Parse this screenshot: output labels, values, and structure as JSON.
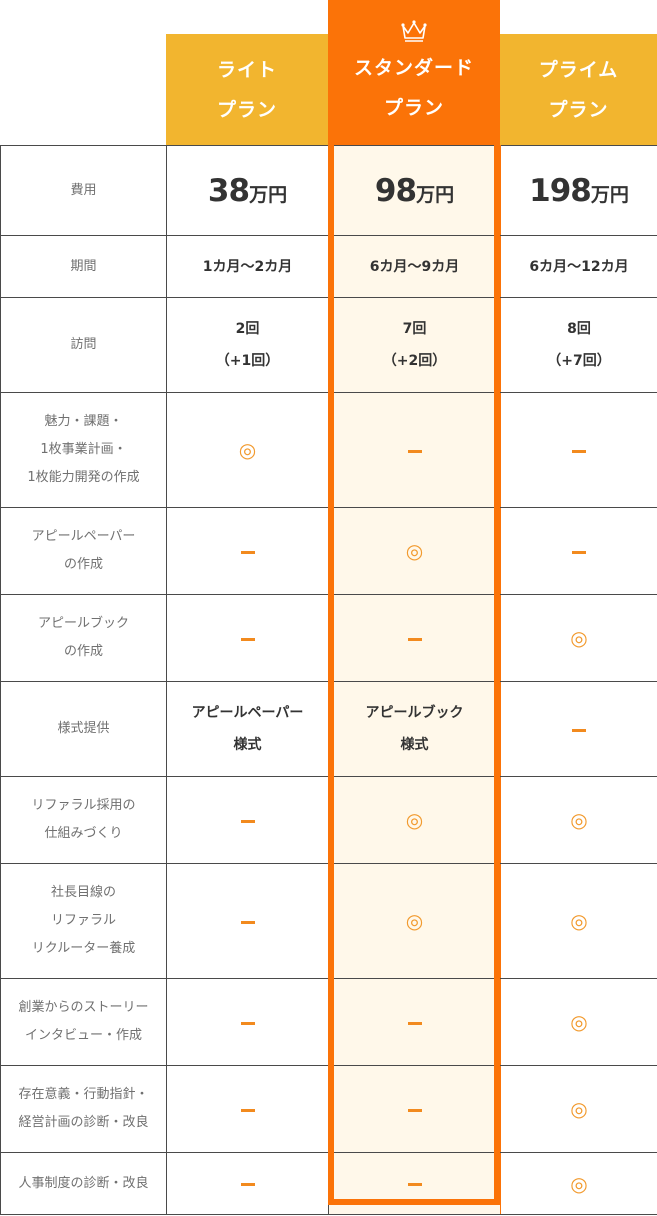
{
  "plans": {
    "light": {
      "line1": "ライト",
      "line2": "プラン"
    },
    "standard": {
      "line1": "スタンダード",
      "line2": "プラン"
    },
    "prime": {
      "line1": "プライム",
      "line2": "プラン"
    }
  },
  "icons": {
    "crown": "crown-icon",
    "double_circle": "◎",
    "dash": "dash-icon"
  },
  "colors": {
    "orange": "#fb7308",
    "yellow": "#f2b52f",
    "highlight_bg": "#fff8ea"
  },
  "rows": {
    "fee": {
      "label": "費用",
      "light_num": "38",
      "light_unit": "万円",
      "standard_num": "98",
      "standard_unit": "万円",
      "prime_num": "198",
      "prime_unit": "万円"
    },
    "period": {
      "label": "期間",
      "light": "1カ月〜2カ月",
      "standard": "6カ月〜9カ月",
      "prime": "6カ月〜12カ月"
    },
    "visits": {
      "label": "訪問",
      "light_1": "2回",
      "light_2": "（+1回）",
      "standard_1": "7回",
      "standard_2": "（+2回）",
      "prime_1": "8回",
      "prime_2": "（+7回）"
    },
    "appeal_plan": {
      "label_1": "魅力・課題・",
      "label_2": "1枚事業計画・",
      "label_3": "1枚能力開発の作成"
    },
    "appeal_paper": {
      "label_1": "アピールペーパー",
      "label_2": "の作成"
    },
    "appeal_book": {
      "label_1": "アピールブック",
      "label_2": "の作成"
    },
    "format": {
      "label": "様式提供",
      "light_1": "アピールペーパー",
      "light_2": "様式",
      "standard_1": "アピールブック",
      "standard_2": "様式"
    },
    "referral": {
      "label_1": "リファラル採用の",
      "label_2": "仕組みづくり"
    },
    "recruiter": {
      "label_1": "社長目線の",
      "label_2": "リファラル",
      "label_3": "リクルーター養成"
    },
    "story": {
      "label_1": "創業からのストーリー",
      "label_2": "インタビュー・作成"
    },
    "purpose": {
      "label_1": "存在意義・行動指針・",
      "label_2": "経営計画の診断・改良"
    },
    "hr": {
      "label": "人事制度の診断・改良"
    }
  }
}
